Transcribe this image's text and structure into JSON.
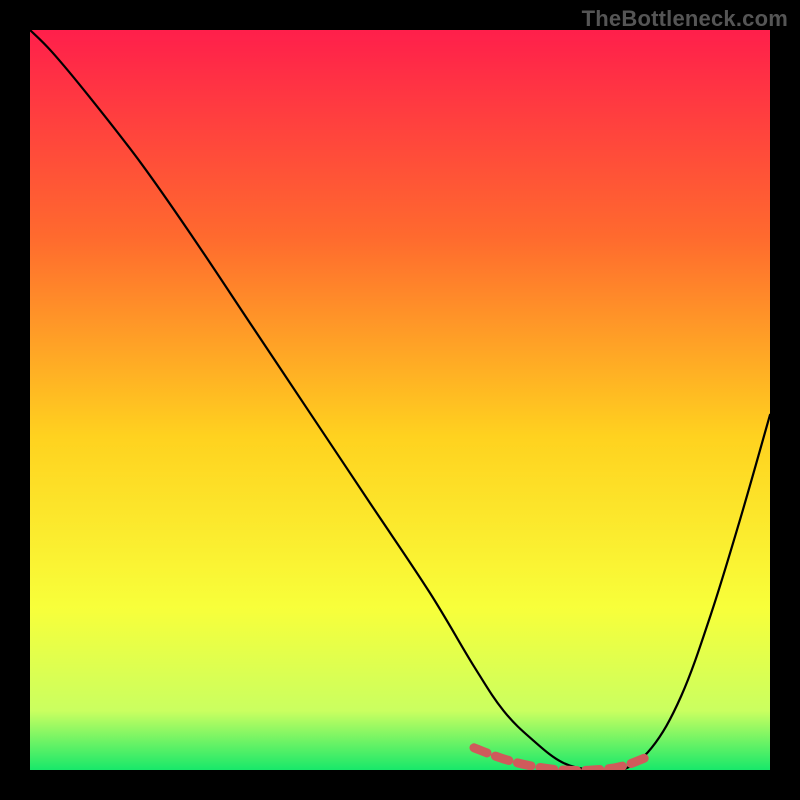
{
  "watermark": "TheBottleneck.com",
  "chart_data": {
    "type": "line",
    "title": "",
    "xlabel": "",
    "ylabel": "",
    "xlim": [
      0,
      100
    ],
    "ylim": [
      0,
      100
    ],
    "grid": false,
    "legend": false,
    "gradient_stops": [
      {
        "offset": 0,
        "color": "#ff1f4b"
      },
      {
        "offset": 0.28,
        "color": "#ff6a2e"
      },
      {
        "offset": 0.55,
        "color": "#ffd21f"
      },
      {
        "offset": 0.78,
        "color": "#f8ff3a"
      },
      {
        "offset": 0.92,
        "color": "#caff60"
      },
      {
        "offset": 1.0,
        "color": "#17e86a"
      }
    ],
    "series": [
      {
        "name": "bottleneck-curve",
        "x": [
          0,
          3,
          8,
          15,
          22,
          30,
          38,
          46,
          54,
          60,
          64,
          68,
          72,
          76,
          80,
          84,
          88,
          92,
          96,
          100
        ],
        "y": [
          100,
          97,
          91,
          82,
          72,
          60,
          48,
          36,
          24,
          14,
          8,
          4,
          1,
          0,
          0,
          3,
          10,
          21,
          34,
          48
        ]
      }
    ],
    "sweet_spot": {
      "color": "#cf5b5b",
      "x": [
        60,
        64,
        68,
        72,
        76,
        80,
        84
      ],
      "y": [
        3,
        1.5,
        0.5,
        0,
        0,
        0.5,
        2
      ]
    }
  }
}
